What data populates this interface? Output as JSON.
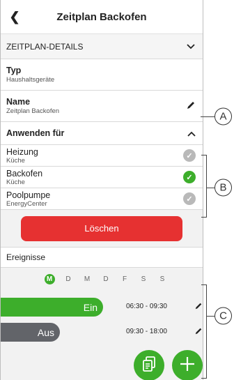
{
  "header": {
    "back_icon": "chevron-left-icon",
    "title": "Zeitplan Backofen"
  },
  "details_section": {
    "label": "ZEITPLAN-DETAILS",
    "icon": "chevron-down-icon"
  },
  "type_row": {
    "label": "Typ",
    "value": "Haushaltsgeräte"
  },
  "name_row": {
    "label": "Name",
    "value": "Zeitplan Backofen",
    "icon": "pencil-icon"
  },
  "apply_section": {
    "label": "Anwenden für",
    "icon": "chevron-up-icon"
  },
  "appliances": [
    {
      "name": "Heizung",
      "location": "Küche",
      "selected": false
    },
    {
      "name": "Backofen",
      "location": "Küche",
      "selected": true
    },
    {
      "name": "Poolpumpe",
      "location": "EnergyCenter",
      "selected": false
    }
  ],
  "delete_button": {
    "label": "Löschen"
  },
  "events_section": {
    "label": "Ereignisse"
  },
  "days": [
    "M",
    "D",
    "M",
    "D",
    "F",
    "S",
    "S"
  ],
  "active_day_index": 0,
  "events": [
    {
      "label": "Ein",
      "time": "06:30 - 09:30"
    },
    {
      "label": "Aus",
      "time": "09:30 - 18:00"
    }
  ],
  "callouts": [
    "A",
    "B",
    "C"
  ],
  "colors": {
    "accent": "#3dae2b",
    "danger": "#e63131",
    "off_pill": "#626469"
  }
}
